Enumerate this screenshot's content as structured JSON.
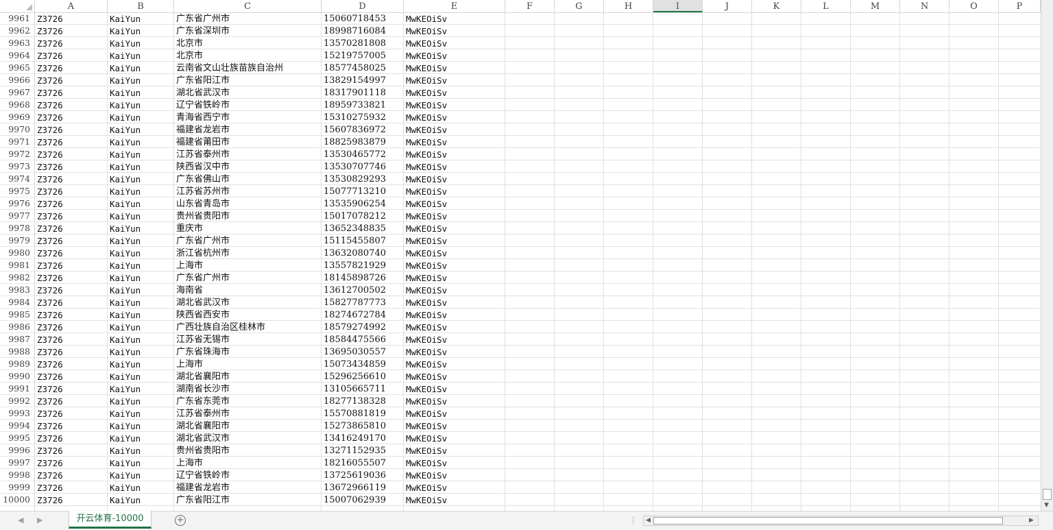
{
  "columns": [
    "A",
    "B",
    "C",
    "D",
    "E",
    "F",
    "G",
    "H",
    "I",
    "J",
    "K",
    "L",
    "M",
    "N",
    "O",
    "P"
  ],
  "selected_column": "I",
  "rows": [
    {
      "n": "9961",
      "a": "Z3726",
      "b": "KaiYun",
      "c": "广东省广州市",
      "d": "15060718453",
      "e": "MwKEOiSv"
    },
    {
      "n": "9962",
      "a": "Z3726",
      "b": "KaiYun",
      "c": "广东省深圳市",
      "d": "18998716084",
      "e": "MwKEOiSv"
    },
    {
      "n": "9963",
      "a": "Z3726",
      "b": "KaiYun",
      "c": "北京市",
      "d": "13570281808",
      "e": "MwKEOiSv"
    },
    {
      "n": "9964",
      "a": "Z3726",
      "b": "KaiYun",
      "c": "北京市",
      "d": "15219757005",
      "e": "MwKEOiSv"
    },
    {
      "n": "9965",
      "a": "Z3726",
      "b": "KaiYun",
      "c": "云南省文山壮族苗族自治州",
      "d": "18577458025",
      "e": "MwKEOiSv"
    },
    {
      "n": "9966",
      "a": "Z3726",
      "b": "KaiYun",
      "c": "广东省阳江市",
      "d": "13829154997",
      "e": "MwKEOiSv"
    },
    {
      "n": "9967",
      "a": "Z3726",
      "b": "KaiYun",
      "c": "湖北省武汉市",
      "d": "18317901118",
      "e": "MwKEOiSv"
    },
    {
      "n": "9968",
      "a": "Z3726",
      "b": "KaiYun",
      "c": "辽宁省铁岭市",
      "d": "18959733821",
      "e": "MwKEOiSv"
    },
    {
      "n": "9969",
      "a": "Z3726",
      "b": "KaiYun",
      "c": "青海省西宁市",
      "d": "15310275932",
      "e": "MwKEOiSv"
    },
    {
      "n": "9970",
      "a": "Z3726",
      "b": "KaiYun",
      "c": "福建省龙岩市",
      "d": "15607836972",
      "e": "MwKEOiSv"
    },
    {
      "n": "9971",
      "a": "Z3726",
      "b": "KaiYun",
      "c": "福建省莆田市",
      "d": "18825983879",
      "e": "MwKEOiSv"
    },
    {
      "n": "9972",
      "a": "Z3726",
      "b": "KaiYun",
      "c": "江苏省泰州市",
      "d": "13530465772",
      "e": "MwKEOiSv"
    },
    {
      "n": "9973",
      "a": "Z3726",
      "b": "KaiYun",
      "c": "陕西省汉中市",
      "d": "13530707746",
      "e": "MwKEOiSv"
    },
    {
      "n": "9974",
      "a": "Z3726",
      "b": "KaiYun",
      "c": "广东省佛山市",
      "d": "13530829293",
      "e": "MwKEOiSv"
    },
    {
      "n": "9975",
      "a": "Z3726",
      "b": "KaiYun",
      "c": "江苏省苏州市",
      "d": "15077713210",
      "e": "MwKEOiSv"
    },
    {
      "n": "9976",
      "a": "Z3726",
      "b": "KaiYun",
      "c": "山东省青岛市",
      "d": "13535906254",
      "e": "MwKEOiSv"
    },
    {
      "n": "9977",
      "a": "Z3726",
      "b": "KaiYun",
      "c": "贵州省贵阳市",
      "d": "15017078212",
      "e": "MwKEOiSv"
    },
    {
      "n": "9978",
      "a": "Z3726",
      "b": "KaiYun",
      "c": "重庆市",
      "d": "13652348835",
      "e": "MwKEOiSv"
    },
    {
      "n": "9979",
      "a": "Z3726",
      "b": "KaiYun",
      "c": "广东省广州市",
      "d": "15115455807",
      "e": "MwKEOiSv"
    },
    {
      "n": "9980",
      "a": "Z3726",
      "b": "KaiYun",
      "c": "浙江省杭州市",
      "d": "13632080740",
      "e": "MwKEOiSv"
    },
    {
      "n": "9981",
      "a": "Z3726",
      "b": "KaiYun",
      "c": "上海市",
      "d": "13557821929",
      "e": "MwKEOiSv"
    },
    {
      "n": "9982",
      "a": "Z3726",
      "b": "KaiYun",
      "c": "广东省广州市",
      "d": "18145898726",
      "e": "MwKEOiSv"
    },
    {
      "n": "9983",
      "a": "Z3726",
      "b": "KaiYun",
      "c": "海南省",
      "d": "13612700502",
      "e": "MwKEOiSv"
    },
    {
      "n": "9984",
      "a": "Z3726",
      "b": "KaiYun",
      "c": "湖北省武汉市",
      "d": "15827787773",
      "e": "MwKEOiSv"
    },
    {
      "n": "9985",
      "a": "Z3726",
      "b": "KaiYun",
      "c": "陕西省西安市",
      "d": "18274672784",
      "e": "MwKEOiSv"
    },
    {
      "n": "9986",
      "a": "Z3726",
      "b": "KaiYun",
      "c": "广西壮族自治区桂林市",
      "d": "18579274992",
      "e": "MwKEOiSv"
    },
    {
      "n": "9987",
      "a": "Z3726",
      "b": "KaiYun",
      "c": "江苏省无锡市",
      "d": "18584475566",
      "e": "MwKEOiSv"
    },
    {
      "n": "9988",
      "a": "Z3726",
      "b": "KaiYun",
      "c": "广东省珠海市",
      "d": "13695030557",
      "e": "MwKEOiSv"
    },
    {
      "n": "9989",
      "a": "Z3726",
      "b": "KaiYun",
      "c": "上海市",
      "d": "15073434859",
      "e": "MwKEOiSv"
    },
    {
      "n": "9990",
      "a": "Z3726",
      "b": "KaiYun",
      "c": "湖北省襄阳市",
      "d": "15296256610",
      "e": "MwKEOiSv"
    },
    {
      "n": "9991",
      "a": "Z3726",
      "b": "KaiYun",
      "c": "湖南省长沙市",
      "d": "13105665711",
      "e": "MwKEOiSv"
    },
    {
      "n": "9992",
      "a": "Z3726",
      "b": "KaiYun",
      "c": "广东省东莞市",
      "d": "18277138328",
      "e": "MwKEOiSv"
    },
    {
      "n": "9993",
      "a": "Z3726",
      "b": "KaiYun",
      "c": "江苏省泰州市",
      "d": "15570881819",
      "e": "MwKEOiSv"
    },
    {
      "n": "9994",
      "a": "Z3726",
      "b": "KaiYun",
      "c": "湖北省襄阳市",
      "d": "15273865810",
      "e": "MwKEOiSv"
    },
    {
      "n": "9995",
      "a": "Z3726",
      "b": "KaiYun",
      "c": "湖北省武汉市",
      "d": "13416249170",
      "e": "MwKEOiSv"
    },
    {
      "n": "9996",
      "a": "Z3726",
      "b": "KaiYun",
      "c": "贵州省贵阳市",
      "d": "13271152935",
      "e": "MwKEOiSv"
    },
    {
      "n": "9997",
      "a": "Z3726",
      "b": "KaiYun",
      "c": "上海市",
      "d": "18216055507",
      "e": "MwKEOiSv"
    },
    {
      "n": "9998",
      "a": "Z3726",
      "b": "KaiYun",
      "c": "辽宁省铁岭市",
      "d": "13725619036",
      "e": "MwKEOiSv"
    },
    {
      "n": "9999",
      "a": "Z3726",
      "b": "KaiYun",
      "c": "福建省龙岩市",
      "d": "13672966119",
      "e": "MwKEOiSv"
    },
    {
      "n": "10000",
      "a": "Z3726",
      "b": "KaiYun",
      "c": "广东省阳江市",
      "d": "15007062939",
      "e": "MwKEOiSv"
    }
  ],
  "sheet_tabs": [
    {
      "label": "开云体育-10000",
      "active": true
    }
  ],
  "colors": {
    "accent": "#217346",
    "grid": "#e0e0e0",
    "header_border": "#d4d4d4"
  },
  "icons": {
    "prev_sheet": "chevron-left-icon",
    "next_sheet": "chevron-right-icon",
    "add_sheet": "plus-circle-icon",
    "splitter": "vertical-dots-icon"
  }
}
